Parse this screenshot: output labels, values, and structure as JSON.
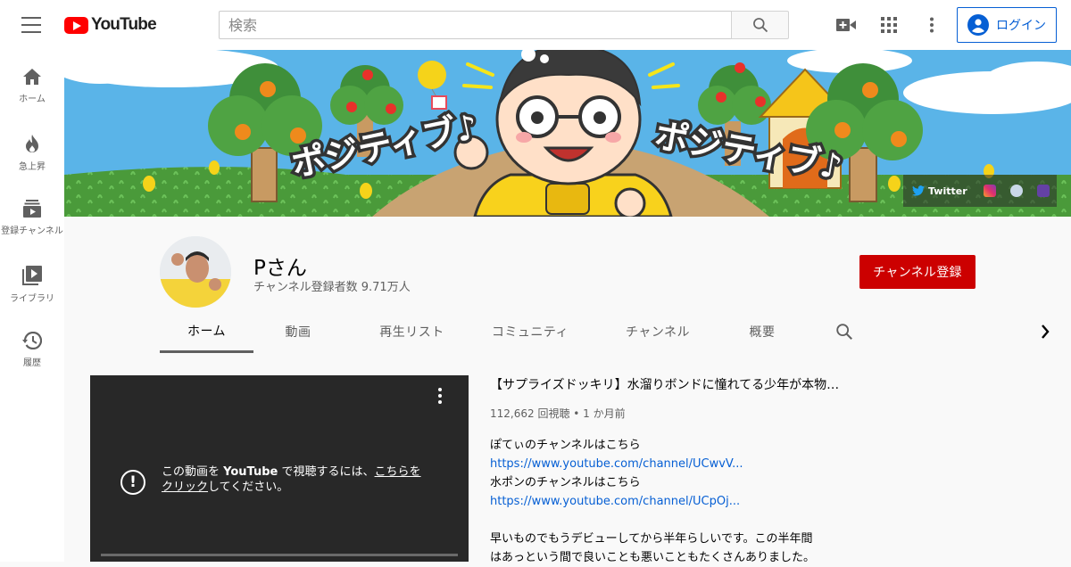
{
  "header": {
    "logo_text": "YouTube",
    "search_placeholder": "検索",
    "login_label": "ログイン"
  },
  "sidebar": {
    "items": [
      {
        "label": "ホーム",
        "icon": "home-icon"
      },
      {
        "label": "急上昇",
        "icon": "fire-icon"
      },
      {
        "label": "登録チャンネル",
        "icon": "subscriptions-icon"
      },
      {
        "label": "ライブラリ",
        "icon": "library-icon"
      },
      {
        "label": "履歴",
        "icon": "history-icon"
      }
    ]
  },
  "banner": {
    "catchphrase_left": "ポジティブ♪",
    "catchphrase_right": "ポジティブ♪",
    "links": {
      "twitter_label": "Twitter",
      "instagram_icon": "instagram-icon",
      "website_icon": "globe-icon",
      "twitch_icon": "twitch-icon"
    },
    "colors": {
      "sky": "#5ab4e8",
      "grass": "#4a9a3a",
      "shirt": "#f8d21c"
    }
  },
  "channel": {
    "name": "Pさん",
    "subscribers": "チャンネル登録者数 9.71万人",
    "subscribe_label": "チャンネル登録",
    "subscribe_color": "#cc0000"
  },
  "tabs": [
    {
      "label": "ホーム",
      "active": true
    },
    {
      "label": "動画",
      "active": false
    },
    {
      "label": "再生リスト",
      "active": false
    },
    {
      "label": "コミュニティ",
      "active": false
    },
    {
      "label": "チャンネル",
      "active": false
    },
    {
      "label": "概要",
      "active": false
    }
  ],
  "featured": {
    "player_msg_prefix": "この動画を ",
    "player_msg_brand": "YouTube",
    "player_msg_mid": " で視聴するには、",
    "player_msg_link1": "こちらを",
    "player_msg_link2": "クリック",
    "player_msg_suffix": "してください。",
    "title": "【サプライズドッキリ】水溜りボンドに憧れてる少年が本物…",
    "meta": "112,662 回視聴 • 1 か月前",
    "desc_line1": "ぽてぃのチャンネルはこちら",
    "desc_link1": "https://www.youtube.com/channel/UCwvV...",
    "desc_line2": "水ポンのチャンネルはこちら",
    "desc_link2": "https://www.youtube.com/channel/UCpOj...",
    "desc_line3": "早いものでもうデビューしてから半年らしいです。この半年間",
    "desc_line4": "はあっという間で良いことも悪いこともたくさんありました。"
  }
}
